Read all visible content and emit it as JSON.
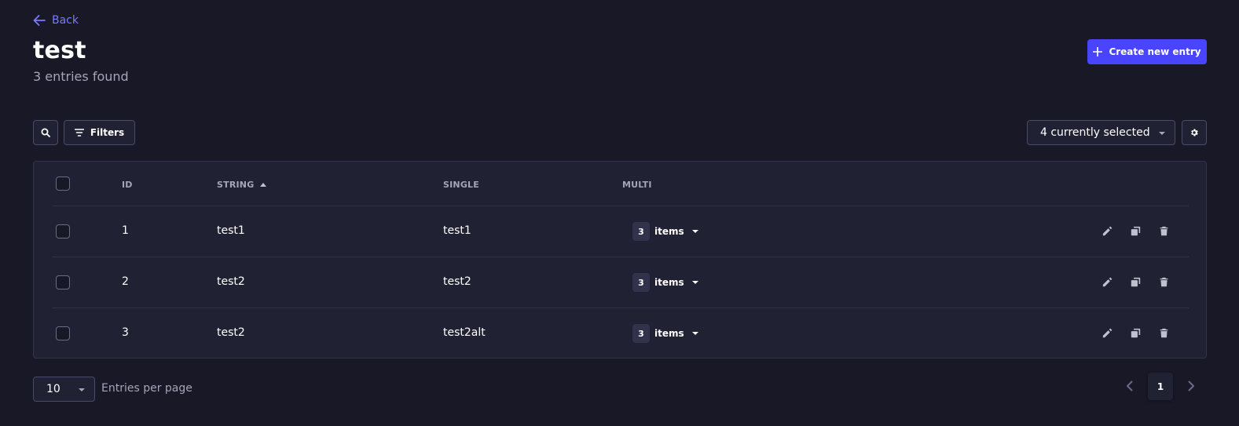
{
  "colors": {
    "background": "#181826",
    "surface": "#212134",
    "primary": "#4945ff",
    "link": "#7b79ff",
    "muted_text": "#a5a5ba",
    "border": "#32324d"
  },
  "header": {
    "back_label": "Back",
    "back_icon": "arrow-left-icon",
    "title": "test",
    "subtitle": "3 entries found",
    "create_label": "Create new entry",
    "create_icon": "plus-icon"
  },
  "toolbar": {
    "search_icon": "search-icon",
    "filters_label": "Filters",
    "filters_icon": "filter-icon",
    "columns_select_value": "4 currently selected",
    "settings_icon": "gear-icon"
  },
  "table": {
    "headers": {
      "id": "ID",
      "string": "STRING",
      "single": "SINGLE",
      "multi": "MULTI"
    },
    "sort_column": "STRING",
    "sort_direction": "ascending",
    "rows": [
      {
        "id": "1",
        "string": "test1",
        "single": "test1",
        "multi_count": "3",
        "multi_label": "items"
      },
      {
        "id": "2",
        "string": "test2",
        "single": "test2",
        "multi_count": "3",
        "multi_label": "items"
      },
      {
        "id": "3",
        "string": "test2",
        "single": "test2alt",
        "multi_count": "3",
        "multi_label": "items"
      }
    ],
    "row_actions": [
      "pencil-icon",
      "duplicate-icon",
      "trash-icon"
    ]
  },
  "footer": {
    "per_page_value": "10",
    "per_page_label": "Entries per page",
    "current_page": "1"
  }
}
